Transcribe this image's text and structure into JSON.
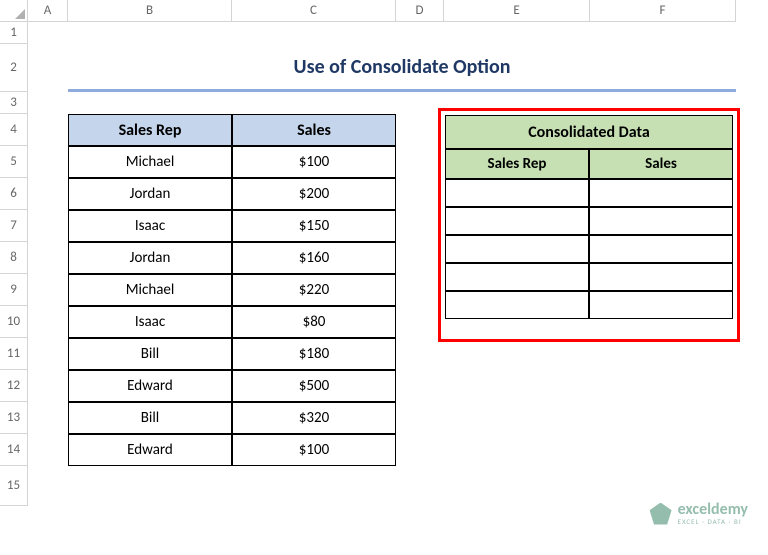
{
  "columns": [
    "A",
    "B",
    "C",
    "D",
    "E",
    "F"
  ],
  "rows": [
    "1",
    "2",
    "3",
    "4",
    "5",
    "6",
    "7",
    "8",
    "9",
    "10",
    "11",
    "12",
    "13",
    "14",
    "15"
  ],
  "title": "Use of Consolidate Option",
  "table1": {
    "headers": [
      "Sales Rep",
      "Sales"
    ],
    "rows": [
      [
        "Michael",
        "$100"
      ],
      [
        "Jordan",
        "$200"
      ],
      [
        "Isaac",
        "$150"
      ],
      [
        "Jordan",
        "$160"
      ],
      [
        "Michael",
        "$220"
      ],
      [
        "Isaac",
        "$80"
      ],
      [
        "Bill",
        "$180"
      ],
      [
        "Edward",
        "$500"
      ],
      [
        "Bill",
        "$320"
      ],
      [
        "Edward",
        "$100"
      ]
    ]
  },
  "consolidated": {
    "title": "Consolidated Data",
    "headers": [
      "Sales Rep",
      "Sales"
    ]
  },
  "watermark": {
    "brand": "exceldemy",
    "tag": "EXCEL · DATA · BI"
  }
}
